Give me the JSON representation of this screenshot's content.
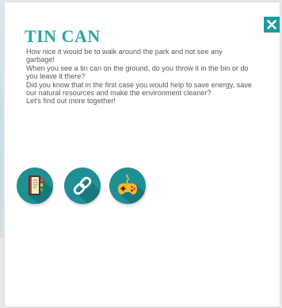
{
  "title": "TIN CAN",
  "paragraphs": [
    "How nice it would be to walk around the park and not see any garbage!",
    "When you see a tin can on the ground, do you throw it in the bin or do you leave it there?",
    "Did you know that in the first case you would help to save energy, save our natural resources and make the environment cleaner?",
    "Let's find out more together!"
  ],
  "close": {
    "icon": "close-icon"
  },
  "actions": [
    {
      "icon": "book-icon"
    },
    {
      "icon": "link-icon"
    },
    {
      "icon": "gamepad-icon"
    }
  ],
  "colors": {
    "accent": "#2aa3a5",
    "close_bg": "#1f9b9c",
    "icon_bg": "#1f8f94",
    "text": "#555a5d",
    "page_bg": "#e9eaeb"
  }
}
